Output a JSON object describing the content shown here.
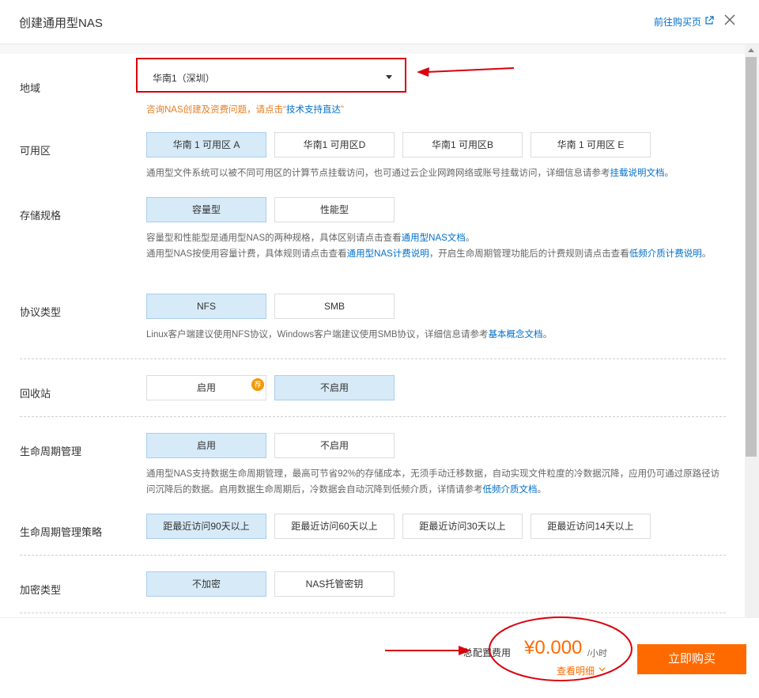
{
  "header": {
    "title": "创建通用型NAS",
    "buy_link": "前往购买页"
  },
  "region": {
    "label": "地域",
    "value": "华南1（深圳）",
    "consult_prefix": "咨询NAS创建及资费问题，请点击“",
    "consult_link": "技术支持直达",
    "consult_suffix": "”"
  },
  "zone": {
    "label": "可用区",
    "options": [
      "华南 1 可用区 A",
      "华南1 可用区D",
      "华南1 可用区B",
      "华南 1 可用区 E"
    ],
    "selected_index": 0,
    "help_prefix": "通用型文件系统可以被不同可用区的计算节点挂载访问，也可通过云企业网跨网络或账号挂载访问，详细信息请参考",
    "help_link": "挂载说明文档",
    "help_suffix": "。"
  },
  "storage": {
    "label": "存储规格",
    "options": [
      "容量型",
      "性能型"
    ],
    "selected_index": 0,
    "help1_prefix": "容量型和性能型是通用型NAS的两种规格，具体区别请点击查看",
    "help1_link": "通用型NAS文档",
    "help1_suffix": "。",
    "help2_prefix": "通用型NAS按使用容量计费，具体规则请点击查看",
    "help2_link1": "通用型NAS计费说明",
    "help2_mid": "，开启生命周期管理功能后的计费规则请点击查看",
    "help2_link2": "低频介质计费说明",
    "help2_suffix": "。"
  },
  "protocol": {
    "label": "协议类型",
    "options": [
      "NFS",
      "SMB"
    ],
    "selected_index": 0,
    "help_prefix": "Linux客户端建议使用NFS协议，Windows客户端建议使用SMB协议，详细信息请参考",
    "help_link": "基本概念文档",
    "help_suffix": "。"
  },
  "recycle": {
    "label": "回收站",
    "options": [
      "启用",
      "不启用"
    ],
    "selected_index": 1,
    "badge": "荐"
  },
  "lifecycle": {
    "label": "生命周期管理",
    "options": [
      "启用",
      "不启用"
    ],
    "selected_index": 0,
    "help_prefix": "通用型NAS支持数据生命周期管理，最高可节省92%的存储成本，无须手动迁移数据，自动实现文件粒度的冷数据沉降，应用仍可通过原路径访问沉降后的数据。启用数据生命周期后，冷数据会自动沉降到低频介质，详情请参考",
    "help_link": "低频介质文档",
    "help_suffix": "。"
  },
  "policy": {
    "label": "生命周期管理策略",
    "options": [
      "距最近访问90天以上",
      "距最近访问60天以上",
      "距最近访问30天以上",
      "距最近访问14天以上"
    ],
    "selected_index": 0
  },
  "encryption": {
    "label": "加密类型",
    "options": [
      "不加密",
      "NAS托管密钥"
    ],
    "selected_index": 0
  },
  "footer": {
    "fee_label": "总配置费用",
    "price": "¥0.000",
    "unit": "/小时",
    "detail": "查看明细",
    "buy_button": "立即购买"
  },
  "colors": {
    "accent": "#ff6a00",
    "link": "#0070cc",
    "selected_bg": "#d7eaf8",
    "annotation_red": "#d9000b"
  }
}
